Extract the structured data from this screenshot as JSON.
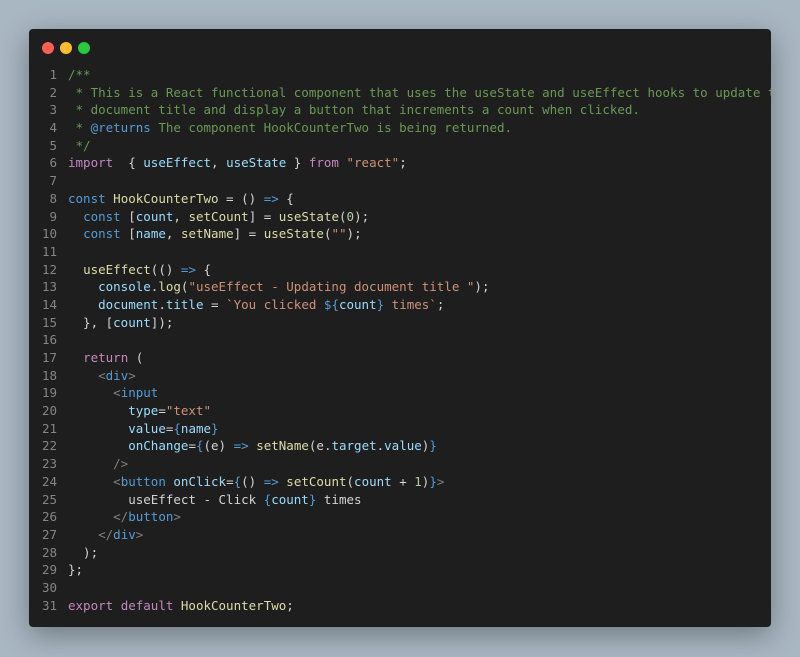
{
  "window_controls": [
    "close",
    "minimize",
    "maximize"
  ],
  "lines": [
    [
      [
        "cm",
        "/**"
      ]
    ],
    [
      [
        "cm",
        " * This is a React functional component that uses the useState and useEffect hooks to update the"
      ]
    ],
    [
      [
        "cm",
        " * document title and display a button that increments a count when clicked."
      ]
    ],
    [
      [
        "cm",
        " * "
      ],
      [
        "st",
        "@returns"
      ],
      [
        "cm",
        " The component HookCounterTwo is being returned."
      ]
    ],
    [
      [
        "cm",
        " */"
      ]
    ],
    [
      [
        "kw",
        "import"
      ],
      [
        "",
        "  { "
      ],
      [
        "vr",
        "useEffect"
      ],
      [
        "",
        ", "
      ],
      [
        "vr",
        "useState"
      ],
      [
        "",
        " } "
      ],
      [
        "kw",
        "from"
      ],
      [
        "sg",
        " \"react\""
      ],
      [
        "",
        ";"
      ]
    ],
    [],
    [
      [
        "st",
        "const"
      ],
      [
        "",
        " "
      ],
      [
        "fn",
        "HookCounterTwo"
      ],
      [
        "",
        " = () "
      ],
      [
        "st",
        "=>"
      ],
      [
        "",
        " {"
      ]
    ],
    [
      [
        "",
        "  "
      ],
      [
        "st",
        "const"
      ],
      [
        "",
        " ["
      ],
      [
        "vr",
        "count"
      ],
      [
        "",
        ", "
      ],
      [
        "fn",
        "setCount"
      ],
      [
        "",
        "] = "
      ],
      [
        "fn",
        "useState"
      ],
      [
        "",
        "("
      ],
      [
        "nu",
        "0"
      ],
      [
        "",
        ");"
      ]
    ],
    [
      [
        "",
        "  "
      ],
      [
        "st",
        "const"
      ],
      [
        "",
        " ["
      ],
      [
        "vr",
        "name"
      ],
      [
        "",
        ", "
      ],
      [
        "fn",
        "setName"
      ],
      [
        "",
        "] = "
      ],
      [
        "fn",
        "useState"
      ],
      [
        "",
        "("
      ],
      [
        "sg",
        "\"\""
      ],
      [
        "",
        ");"
      ]
    ],
    [],
    [
      [
        "",
        "  "
      ],
      [
        "fn",
        "useEffect"
      ],
      [
        "",
        "(() "
      ],
      [
        "st",
        "=>"
      ],
      [
        "",
        " {"
      ]
    ],
    [
      [
        "",
        "    "
      ],
      [
        "vr",
        "console"
      ],
      [
        "",
        "."
      ],
      [
        "fn",
        "log"
      ],
      [
        "",
        "("
      ],
      [
        "sg",
        "\"useEffect - Updating document title \""
      ],
      [
        "",
        ");"
      ]
    ],
    [
      [
        "",
        "    "
      ],
      [
        "vr",
        "document"
      ],
      [
        "",
        "."
      ],
      [
        "vr",
        "title"
      ],
      [
        "",
        " = "
      ],
      [
        "sg",
        "`You clicked "
      ],
      [
        "st",
        "${"
      ],
      [
        "vr",
        "count"
      ],
      [
        "st",
        "}"
      ],
      [
        "sg",
        " times`"
      ],
      [
        "",
        ";"
      ]
    ],
    [
      [
        "",
        "  }, ["
      ],
      [
        "vr",
        "count"
      ],
      [
        "",
        "]);"
      ]
    ],
    [],
    [
      [
        "",
        "  "
      ],
      [
        "kw",
        "return"
      ],
      [
        "",
        " ("
      ]
    ],
    [
      [
        "",
        "    "
      ],
      [
        "pn",
        "<"
      ],
      [
        "tg",
        "div"
      ],
      [
        "pn",
        ">"
      ]
    ],
    [
      [
        "",
        "      "
      ],
      [
        "pn",
        "<"
      ],
      [
        "tg",
        "input"
      ]
    ],
    [
      [
        "",
        "        "
      ],
      [
        "vr",
        "type"
      ],
      [
        "",
        "="
      ],
      [
        "sg",
        "\"text\""
      ]
    ],
    [
      [
        "",
        "        "
      ],
      [
        "vr",
        "value"
      ],
      [
        "",
        "="
      ],
      [
        "st",
        "{"
      ],
      [
        "vr",
        "name"
      ],
      [
        "st",
        "}"
      ]
    ],
    [
      [
        "",
        "        "
      ],
      [
        "vr",
        "onChange"
      ],
      [
        "",
        "="
      ],
      [
        "st",
        "{"
      ],
      [
        "",
        "(e) "
      ],
      [
        "st",
        "=>"
      ],
      [
        "",
        " "
      ],
      [
        "fn",
        "setName"
      ],
      [
        "",
        "(e."
      ],
      [
        "vr",
        "target"
      ],
      [
        "",
        "."
      ],
      [
        "vr",
        "value"
      ],
      [
        "",
        ")"
      ],
      [
        "st",
        "}"
      ]
    ],
    [
      [
        "",
        "      "
      ],
      [
        "pn",
        "/>"
      ]
    ],
    [
      [
        "",
        "      "
      ],
      [
        "pn",
        "<"
      ],
      [
        "tg",
        "button"
      ],
      [
        "",
        " "
      ],
      [
        "vr",
        "onClick"
      ],
      [
        "",
        "="
      ],
      [
        "st",
        "{"
      ],
      [
        "",
        "() "
      ],
      [
        "st",
        "=>"
      ],
      [
        "",
        " "
      ],
      [
        "fn",
        "setCount"
      ],
      [
        "",
        "("
      ],
      [
        "vr",
        "count"
      ],
      [
        "",
        " + "
      ],
      [
        "nu",
        "1"
      ],
      [
        "",
        ")"
      ],
      [
        "st",
        "}"
      ],
      [
        "pn",
        ">"
      ]
    ],
    [
      [
        "",
        "        useEffect - Click "
      ],
      [
        "st",
        "{"
      ],
      [
        "vr",
        "count"
      ],
      [
        "st",
        "}"
      ],
      [
        "",
        " times"
      ]
    ],
    [
      [
        "",
        "      "
      ],
      [
        "pn",
        "</"
      ],
      [
        "tg",
        "button"
      ],
      [
        "pn",
        ">"
      ]
    ],
    [
      [
        "",
        "    "
      ],
      [
        "pn",
        "</"
      ],
      [
        "tg",
        "div"
      ],
      [
        "pn",
        ">"
      ]
    ],
    [
      [
        "",
        "  );"
      ]
    ],
    [
      [
        "",
        "};"
      ]
    ],
    [],
    [
      [
        "kw",
        "export"
      ],
      [
        "",
        " "
      ],
      [
        "kw",
        "default"
      ],
      [
        "",
        " "
      ],
      [
        "fn",
        "HookCounterTwo"
      ],
      [
        "",
        ";"
      ]
    ]
  ]
}
